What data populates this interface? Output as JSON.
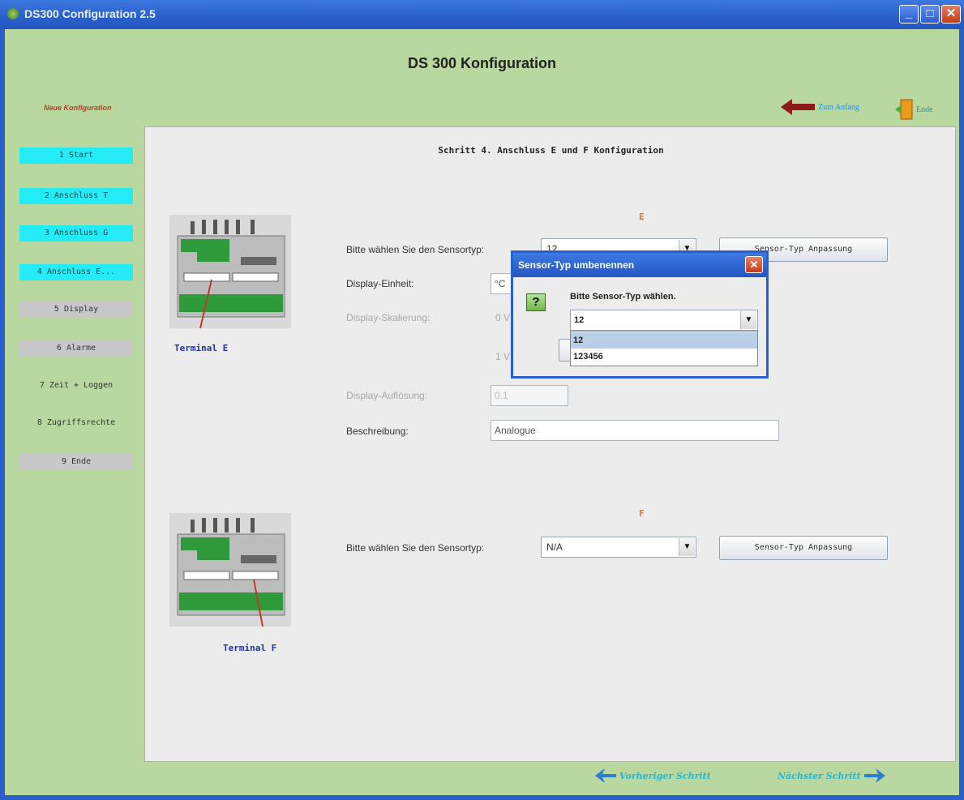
{
  "window": {
    "title": "DS300 Configuration 2.5"
  },
  "header": {
    "title": "DS 300 Konfiguration",
    "new_config": "Neue Konfiguration"
  },
  "toplinks": {
    "home": "Zum Anfang",
    "exit": "Ende"
  },
  "sidebar": {
    "items": [
      {
        "label": "1 Start",
        "state": "cyan"
      },
      {
        "label": "2 Anschluss T",
        "state": "cyan"
      },
      {
        "label": "3 Anschluss G",
        "state": "cyan"
      },
      {
        "label": "4 Anschluss E...",
        "state": "cyan"
      },
      {
        "label": "5 Display",
        "state": "grey"
      },
      {
        "label": "6 Alarme",
        "state": "grey"
      },
      {
        "label": "7 Zeit + Loggen",
        "state": "plain"
      },
      {
        "label": "8 Zugriffsrechte",
        "state": "plain"
      },
      {
        "label": "9 Ende",
        "state": "grey"
      }
    ]
  },
  "step": {
    "title": "Schritt 4. Anschluss E und F Konfiguration"
  },
  "section_e": {
    "letter": "E",
    "terminal_label": "Terminal E",
    "sensor_label": "Bitte wählen Sie den Sensortyp:",
    "sensor_value": "12",
    "sensor_button": "Sensor-Typ Anpassung",
    "display_unit_label": "Display-Einheit:",
    "display_unit_value": "°C",
    "scaling_label": "Display-Skalierung:",
    "scaling_v0": "0 V",
    "scaling_v1": "1 V",
    "resolution_label": "Display-Auflösung:",
    "resolution_value": "0.1",
    "description_label": "Beschreibung:",
    "description_value": "Analogue"
  },
  "section_f": {
    "letter": "F",
    "terminal_label": "Terminal F",
    "sensor_label": "Bitte wählen Sie den Sensortyp:",
    "sensor_value": "N/A",
    "sensor_button": "Sensor-Typ Anpassung"
  },
  "dialog": {
    "title": "Sensor-Typ umbenennen",
    "message": "Bitte Sensor-Typ wählen.",
    "selected": "12",
    "options": [
      "12",
      "123456"
    ]
  },
  "footer": {
    "prev": "Vorheriger Schritt",
    "next": "Nächster Schritt"
  },
  "colors": {
    "accent": "#23ecf7",
    "background": "#b8d8a0",
    "titlebar": "#2a5fc9"
  }
}
